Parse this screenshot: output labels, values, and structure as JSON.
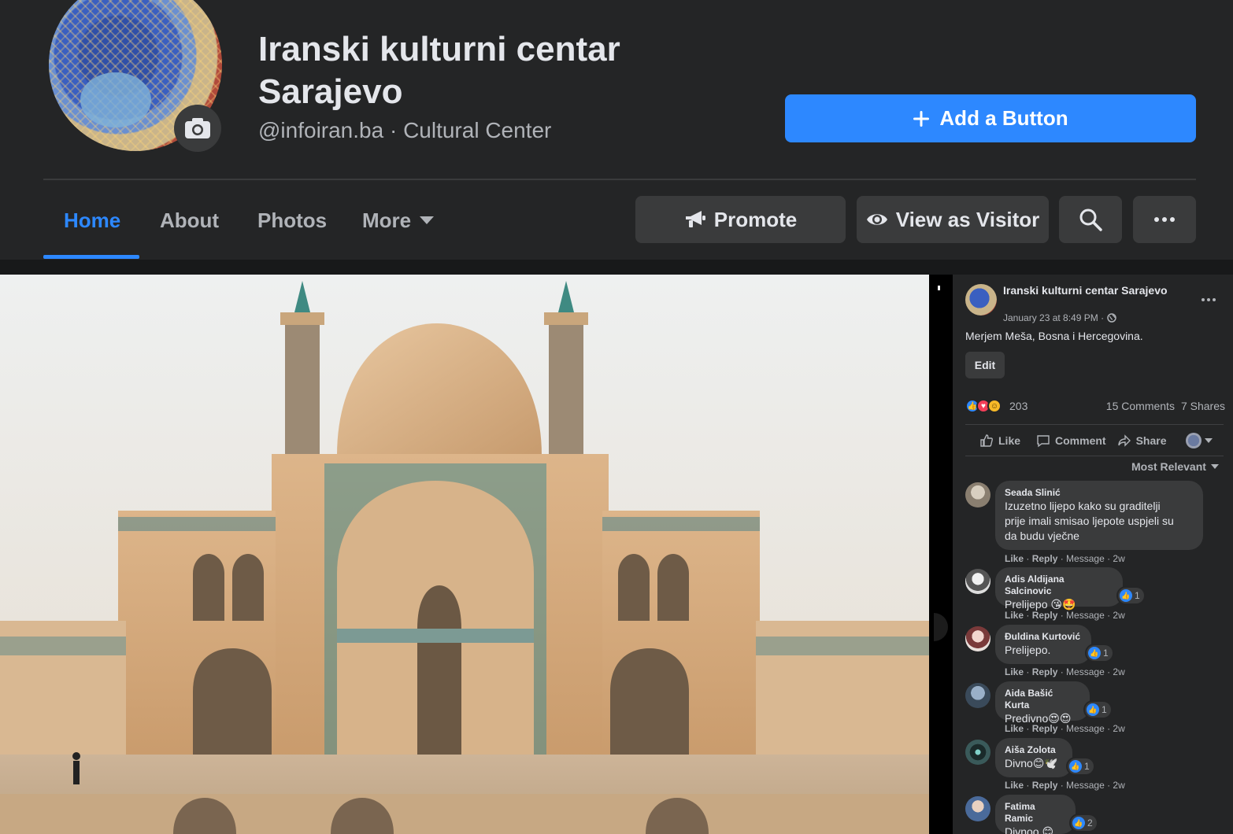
{
  "page": {
    "title": "Iranski kulturni centar Sarajevo",
    "subtitle": "@infoiran.ba · Cultural Center",
    "add_button_label": "Add a Button"
  },
  "nav": {
    "tabs": [
      {
        "label": "Home",
        "active": true
      },
      {
        "label": "About"
      },
      {
        "label": "Photos"
      },
      {
        "label": "More"
      }
    ],
    "actions": {
      "promote": "Promote",
      "view_as_visitor": "View as Visitor"
    }
  },
  "post": {
    "author": "Iranski kulturni centar Sarajevo",
    "time": "January 23 at 8:49 PM ·",
    "text": "Merjem Meša, Bosna i Hercegovina.",
    "edit_label": "Edit",
    "reactions_count": "203",
    "comments_count": "15 Comments",
    "shares_count": "7 Shares",
    "actions": {
      "like": "Like",
      "comment": "Comment",
      "share": "Share"
    },
    "sort_label": "Most Relevant"
  },
  "comments": [
    {
      "name": "Seada Slinić",
      "text_lines": [
        "Izuzetno lijepo kako su graditelji",
        "prije imali smisao ljepote uspjeli su",
        "da budu vječne"
      ],
      "meta": [
        "Like",
        "Reply",
        "Message",
        "2w"
      ],
      "reactions": ""
    },
    {
      "name": "Adis Aldijana Salcinovic",
      "text_lines": [
        "Prelijepo 😘🤩"
      ],
      "meta": [
        "Like",
        "Reply",
        "Message",
        "2w"
      ],
      "reactions": "1"
    },
    {
      "name": "Đuldina Kurtović",
      "text_lines": [
        "Prelijepo."
      ],
      "meta": [
        "Like",
        "Reply",
        "Message",
        "2w"
      ],
      "reactions": "1"
    },
    {
      "name": "Aida Bašić Kurta",
      "text_lines": [
        "Predivno😍😍"
      ],
      "meta": [
        "Like",
        "Reply",
        "Message",
        "2w"
      ],
      "reactions": "1"
    },
    {
      "name": "Aiša Zolota",
      "text_lines": [
        "Divno😊🕊️"
      ],
      "meta": [
        "Like",
        "Reply",
        "Message",
        "2w"
      ],
      "reactions": "1"
    },
    {
      "name": "Fatima Ramic",
      "text_lines": [
        "Divnoo 😊"
      ],
      "meta": [],
      "reactions": "2"
    }
  ],
  "colors": {
    "accent": "#2d88ff",
    "header_bg": "#242526",
    "button_bg": "#3a3b3c",
    "text_primary": "#e4e6eb",
    "text_secondary": "#b0b3b8"
  },
  "icons": [
    "camera-icon",
    "plus-icon",
    "chevron-down-icon",
    "megaphone-icon",
    "eye-icon",
    "search-icon",
    "ellipsis-icon",
    "globe-icon",
    "like-icon",
    "comment-icon",
    "share-icon"
  ]
}
